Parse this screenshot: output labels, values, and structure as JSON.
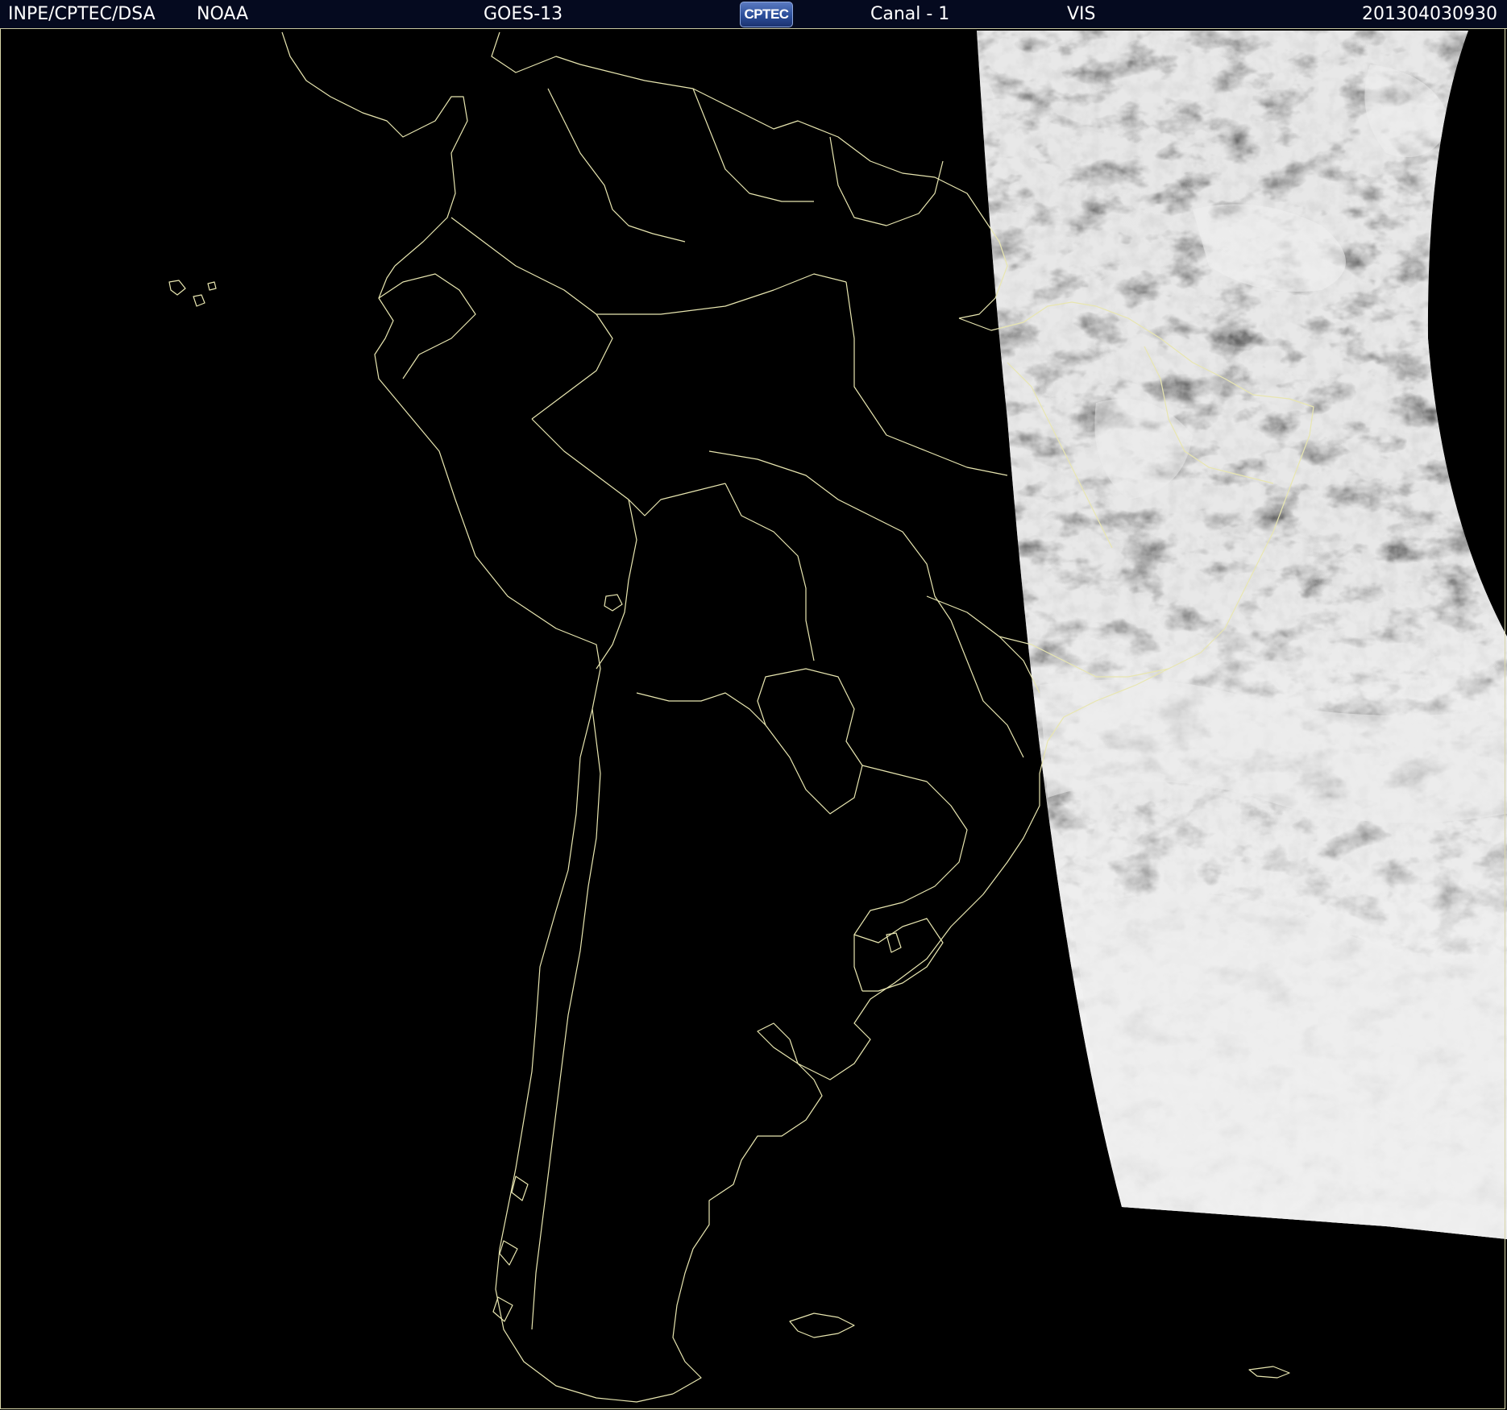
{
  "header": {
    "institution": "INPE/CPTEC/DSA",
    "agency": "NOAA",
    "satellite": "GOES-13",
    "logo_text": "CPTEC",
    "channel": "Canal - 1",
    "band": "VIS",
    "timestamp": "201304030930"
  },
  "colors": {
    "background": "#000000",
    "header_background": "#050a1f",
    "header_text": "#ffffff",
    "coastline": "#e8e6b0",
    "border_lines": "#e8e6b0",
    "cloud_light": "#e6e6e6",
    "cloud_dark": "#6a6a6a",
    "logo_blue": "#2b4e9a"
  },
  "map": {
    "region": "South America",
    "imagery": "visible-satellite-swath",
    "overlays": [
      "coastlines",
      "country-borders",
      "brazil-state-borders"
    ]
  }
}
